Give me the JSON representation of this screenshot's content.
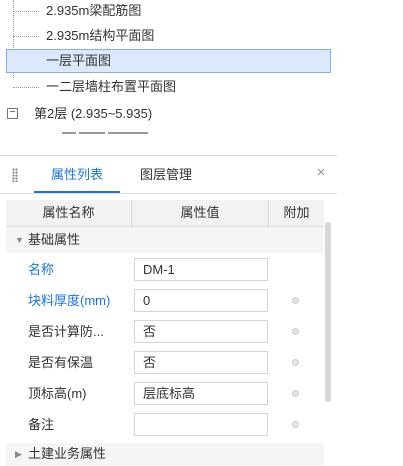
{
  "tree": {
    "items": [
      {
        "label": "2.935m梁配筋图"
      },
      {
        "label": "2.935m结构平面图"
      },
      {
        "label": "一层平面图"
      },
      {
        "label": "一二层墙柱布置平面图"
      }
    ],
    "level": {
      "expander": "−",
      "label": "第2层 (2.935~5.935)"
    }
  },
  "props": {
    "tabs": [
      {
        "label": "属性列表"
      },
      {
        "label": "图层管理"
      }
    ],
    "close": "×",
    "columns": {
      "name": "属性名称",
      "value": "属性值",
      "extra": "附加"
    },
    "group_basic": {
      "arrow": "▼",
      "label": "基础属性"
    },
    "rows": [
      {
        "name": "名称",
        "value": "DM-1"
      },
      {
        "name": "块料厚度(mm)",
        "value": "0"
      },
      {
        "name": "是否计算防...",
        "value": "否"
      },
      {
        "name": "是否有保温",
        "value": "否"
      },
      {
        "name": "顶标高(m)",
        "value": "层底标高"
      },
      {
        "name": "备注",
        "value": ""
      }
    ],
    "group_civil": {
      "arrow": "▶",
      "label": "土建业务属性"
    }
  },
  "colors": {
    "accent": "#1a73e8",
    "selected_bg": "#dbe9fb"
  }
}
